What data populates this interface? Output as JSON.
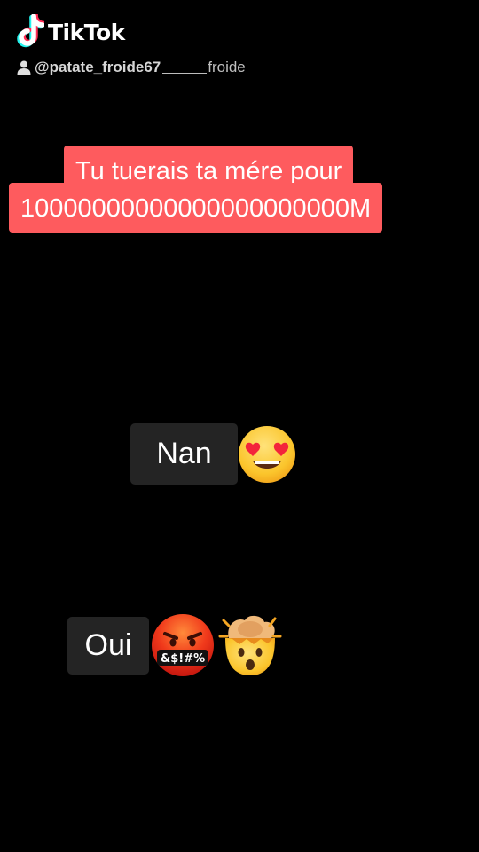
{
  "watermark": {
    "brand": "TikTok",
    "logo_icon": "tiktok-logo-icon",
    "user_icon": "user-icon",
    "handle": "@patate_froide67",
    "handle_tail": "froide"
  },
  "question": {
    "line1": "Tu tuerais ta mére pour",
    "line2": "10000000000000000000000M",
    "background": "#fe5b5e"
  },
  "answers": [
    {
      "label": "Nan",
      "emojis": [
        "heart-eyes-emoji"
      ]
    },
    {
      "label": "Oui",
      "emojis": [
        "cursing-face-emoji",
        "exploding-head-emoji"
      ]
    }
  ]
}
